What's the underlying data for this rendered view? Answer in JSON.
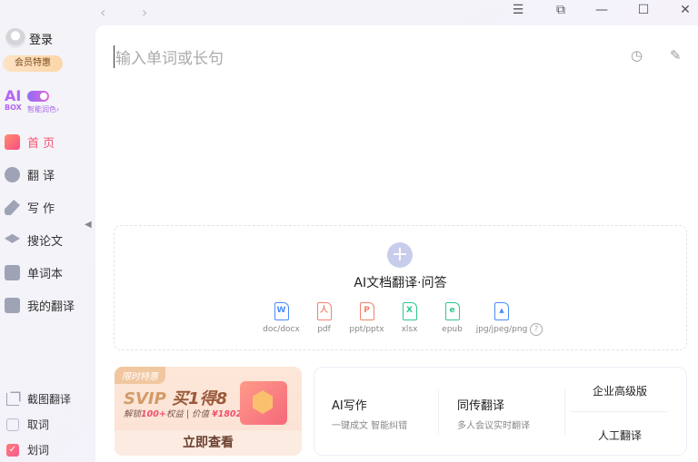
{
  "titlebar": {
    "back": "‹",
    "forward": "›",
    "menu": "☰",
    "minimize": "—",
    "maximize": "☐",
    "close": "✕",
    "pin": "⧉"
  },
  "sidebar": {
    "login": "登录",
    "vip_badge": "会员特惠",
    "aibox": {
      "ai": "AI",
      "box": "BOX",
      "label": "智能润色›"
    },
    "items": [
      {
        "label": "首 页",
        "icon": "home-icon",
        "active": true
      },
      {
        "label": "翻 译",
        "icon": "translate-icon"
      },
      {
        "label": "写 作",
        "icon": "pen-icon"
      },
      {
        "label": "搜论文",
        "icon": "graduation-cap-icon"
      },
      {
        "label": "单词本",
        "icon": "bookmark-book-icon"
      },
      {
        "label": "我的翻译",
        "icon": "my-translation-icon"
      }
    ],
    "bottom": [
      {
        "label": "截图翻译",
        "icon": "crop-icon"
      },
      {
        "label": "取词",
        "checked": false
      },
      {
        "label": "划词",
        "checked": true
      }
    ]
  },
  "main": {
    "input_placeholder": "输入单词或长句",
    "drop": {
      "title": "AI文档翻译·问答",
      "plus": "+",
      "types": [
        {
          "label": "doc/docx",
          "glyph": "W",
          "color": "#4a8cf7"
        },
        {
          "label": "pdf",
          "glyph": "人",
          "color": "#f3806b"
        },
        {
          "label": "ppt/pptx",
          "glyph": "P",
          "color": "#f3806b"
        },
        {
          "label": "xlsx",
          "glyph": "X",
          "color": "#2ec88a"
        },
        {
          "label": "epub",
          "glyph": "e",
          "color": "#2ec88a"
        },
        {
          "label": "jpg/jpeg/png",
          "glyph": "▲",
          "color": "#4a8cf7"
        }
      ],
      "help": "?"
    },
    "promo": {
      "tag": "限时特惠",
      "title_a": "SVIP ",
      "title_b": "买1得8",
      "sub_a": "解锁",
      "sub_b": "100+",
      "sub_c": "权益 | 价值",
      "sub_d": "¥1802",
      "button": "立即查看"
    },
    "features": [
      {
        "title": "AI写作",
        "sub": "一键成文 智能纠错"
      },
      {
        "title": "同传翻译",
        "sub": "多人会议实时翻译"
      }
    ],
    "links": [
      "企业高级版",
      "人工翻译"
    ]
  }
}
